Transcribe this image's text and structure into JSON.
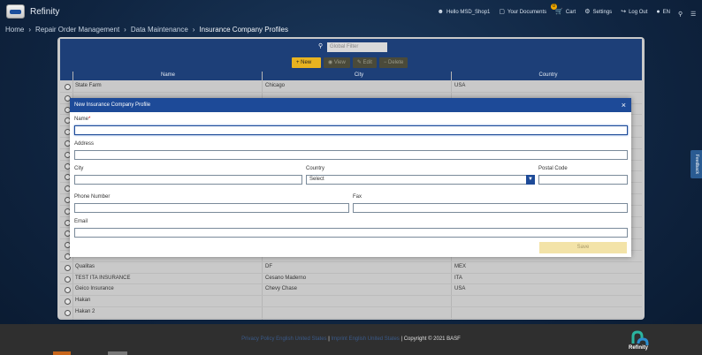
{
  "app": {
    "brand": "Refinity"
  },
  "topnav": {
    "user": "Hello MSD_Shop1",
    "documents": "Your Documents",
    "cart": "Cart",
    "cart_count": "0",
    "settings": "Settings",
    "logout": "Log Out",
    "language": "EN"
  },
  "breadcrumb": [
    "Home",
    "Repair Order Management",
    "Data Maintenance",
    "Insurance Company Profiles"
  ],
  "feedback": "Feedback",
  "grid": {
    "filter_placeholder": "Global Filter",
    "buttons": {
      "new": "New",
      "view": "View",
      "edit": "Edit",
      "delete": "Delete"
    },
    "columns": [
      "Name",
      "City",
      "Country"
    ],
    "rows": [
      {
        "name": "State Farm",
        "city": "Chicago",
        "country": "USA"
      },
      {
        "name": "",
        "city": "",
        "country": ""
      },
      {
        "name": "",
        "city": "",
        "country": ""
      },
      {
        "name": "",
        "city": "",
        "country": ""
      },
      {
        "name": "",
        "city": "",
        "country": ""
      },
      {
        "name": "",
        "city": "",
        "country": ""
      },
      {
        "name": "",
        "city": "",
        "country": ""
      },
      {
        "name": "",
        "city": "",
        "country": ""
      },
      {
        "name": "",
        "city": "",
        "country": ""
      },
      {
        "name": "",
        "city": "",
        "country": ""
      },
      {
        "name": "",
        "city": "",
        "country": ""
      },
      {
        "name": "",
        "city": "",
        "country": ""
      },
      {
        "name": "",
        "city": "",
        "country": ""
      },
      {
        "name": "",
        "city": "",
        "country": ""
      },
      {
        "name": "",
        "city": "",
        "country": ""
      },
      {
        "name": "",
        "city": "",
        "country": ""
      },
      {
        "name": "Qualitas",
        "city": "DF",
        "country": "MEX"
      },
      {
        "name": "TEST ITA INSURANCE",
        "city": "Cesano Maderno",
        "country": "ITA"
      },
      {
        "name": "Geico Insurance",
        "city": "Chevy Chase",
        "country": "USA"
      },
      {
        "name": "Hakan",
        "city": "",
        "country": ""
      },
      {
        "name": "Hakan 2",
        "city": "",
        "country": ""
      }
    ]
  },
  "modal": {
    "title": "New Insurance Company Profile",
    "close": "×",
    "name_label": "Name",
    "name_required": "*",
    "name_value": "",
    "address_label": "Address",
    "city_label": "City",
    "country_label": "Country",
    "country_value": "Select",
    "postal_label": "Postal Code",
    "phone_label": "Phone Number",
    "fax_label": "Fax",
    "email_label": "Email",
    "save": "Save"
  },
  "footer": {
    "privacy": "Privacy Policy English United States",
    "imprint": "Imprint English United States",
    "copyright": "Copyright © 2021 BASF",
    "brand": "Refinity"
  },
  "colors": {
    "header_blue": "#1d3f78",
    "accent": "#e8b320",
    "modal_blue": "#1d4a98"
  }
}
